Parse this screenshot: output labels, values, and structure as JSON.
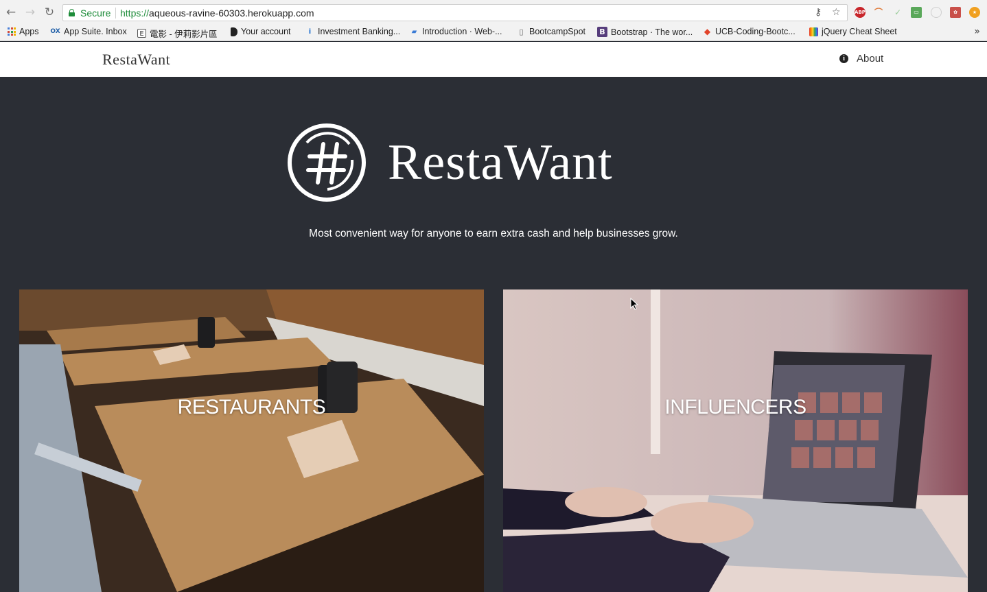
{
  "browser": {
    "secure_label": "Secure",
    "url_scheme": "https://",
    "url_host": "aqueous-ravine-60303.herokuapp.com",
    "bookmarks": [
      {
        "label": "Apps",
        "icon": "apps-grid-icon"
      },
      {
        "label": "App Suite. Inbox",
        "icon": "ox-icon"
      },
      {
        "label": "電影 - 伊莉影片區",
        "icon": "e-page-icon"
      },
      {
        "label": "Your account",
        "icon": "tag-icon"
      },
      {
        "label": "Investment Banking...",
        "icon": "info-person-icon"
      },
      {
        "label": "Introduction · Web-...",
        "icon": "book-icon"
      },
      {
        "label": "BootcampSpot",
        "icon": "page-icon"
      },
      {
        "label": "Bootstrap · The wor...",
        "icon": "bootstrap-icon"
      },
      {
        "label": "UCB-Coding-Bootc...",
        "icon": "gitlab-icon"
      },
      {
        "label": "jQuery Cheat Sheet",
        "icon": "rainbow-icon"
      }
    ],
    "more_bookmarks": "»"
  },
  "nav": {
    "brand": "RestaWant",
    "about": "About"
  },
  "hero": {
    "title": "RestaWant",
    "tagline": "Most convenient way for anyone to earn extra cash and help businesses grow."
  },
  "cards": [
    {
      "label": "RESTAURANTS"
    },
    {
      "label": "INFLUENCERS"
    }
  ],
  "colors": {
    "hero_bg": "#2b2e35",
    "secure_green": "#1e8c3a",
    "navbar_bg": "#ffffff"
  }
}
